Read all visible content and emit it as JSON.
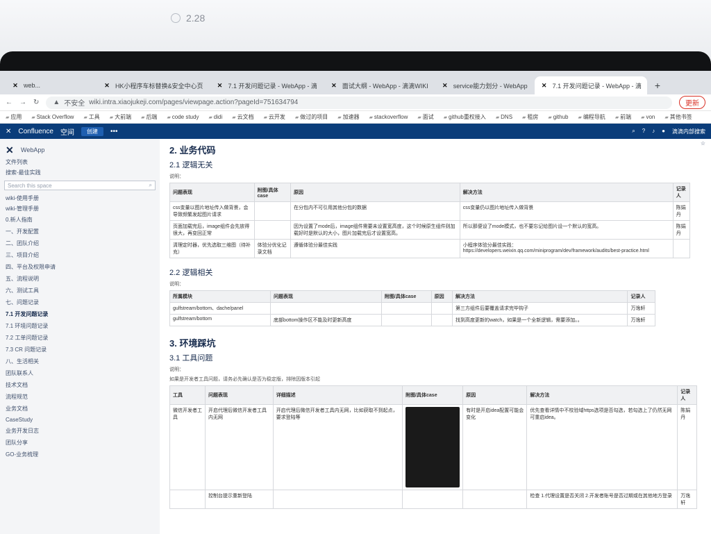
{
  "form": {
    "options": [
      "2.28"
    ]
  },
  "browser": {
    "tabs": [
      {
        "title": "web..."
      },
      {
        "title": "HK小程序车标替换&安全中心页"
      },
      {
        "title": "7.1 开发问题记录 - WebApp - 滴"
      },
      {
        "title": "面试大纲 - WebApp - 滴滴WIKI"
      },
      {
        "title": "service能力划分 - WebApp"
      },
      {
        "title": "7.1 开发问题记录 - WebApp - 滴"
      }
    ],
    "new_tab": "+",
    "insecure": "不安全",
    "url": "wiki.intra.xiaojukeji.com/pages/viewpage.action?pageId=751634794",
    "update_button": "更新",
    "bookmarks": [
      "应用",
      "Stack Overflow",
      "工具",
      "大前端",
      "后端",
      "code study",
      "didi",
      "云文档",
      "云开发",
      "做过的项目",
      "加速器",
      "stackoverflow",
      "面试",
      "github重权接入",
      "DNS",
      "租房",
      "github",
      "编程导航",
      "前端",
      "von",
      "其他书签"
    ]
  },
  "confluence": {
    "logo": "Confluence",
    "space_menu": "空间",
    "create": "创建",
    "more": "•••",
    "user": "滴滴内部搜索"
  },
  "sidebar": {
    "space_name": "WebApp",
    "links": [
      "文件列表",
      "搜索-最佳实践"
    ],
    "search_placeholder": "Search this space",
    "pages": [
      "wiki-使用手册",
      "wiki-管理手册"
    ],
    "tree": [
      {
        "label": "0.新人指南",
        "active": false
      },
      {
        "label": "一、开发配置",
        "active": false
      },
      {
        "label": "二、团队介绍",
        "active": false
      },
      {
        "label": "三、项目介绍",
        "active": false
      },
      {
        "label": "四、平台及权限申请",
        "active": false
      },
      {
        "label": "五、流程说明",
        "active": false
      },
      {
        "label": "六、测试工具",
        "active": false
      },
      {
        "label": "七、问题记录",
        "active": false
      },
      {
        "label": "7.1 开发问题记录",
        "active": true
      },
      {
        "label": "7.1 环境问题记录",
        "active": false
      },
      {
        "label": "7.2 工单问题记录",
        "active": false
      },
      {
        "label": "7.3 CR 问题记录",
        "active": false
      },
      {
        "label": "八、生活相关",
        "active": false
      },
      {
        "label": "团队联系人",
        "active": false
      },
      {
        "label": "技术文档",
        "active": false
      },
      {
        "label": "流程规范",
        "active": false
      },
      {
        "label": "业务文档",
        "active": false
      },
      {
        "label": "CaseStudy",
        "active": false
      },
      {
        "label": "业务开发日志",
        "active": false
      },
      {
        "label": "团队分享",
        "active": false
      },
      {
        "label": "GO-业务梳理",
        "active": false
      }
    ]
  },
  "content": {
    "h_business": "2. 业务代码",
    "h_logic_none": "2.1 逻辑无关",
    "desc1": "说明：",
    "table1": {
      "headers": [
        "问题表现",
        "附图/具体case",
        "原因",
        "解决方法",
        "记录人"
      ],
      "rows": [
        [
          "css变量以图片地址传入做背景，会导致频繁发起图片请求",
          "",
          "在分包内不可引用其他分包的数据",
          "css变量仍以图片地址传入做背景",
          "陈娟丹"
        ],
        [
          "页面加载完后，image组件会先放得很大，再变回正常",
          "",
          "因为设置了mode后，image组件需要未设置宽高度，这个时候原生组件则加载好时是默认的大小，图片加载完后才设置宽高。",
          "所以那便设了mode模式，也不要忘记给图片设一个默认的宽高。",
          "陈娟丹"
        ],
        [
          "清理定时器，优先选取三维图（待补充）",
          "体验分优化记录文档",
          "遵循体验分最佳实践",
          "小程序体验分最佳实践： https://developers.weixin.qq.com/miniprogram/dev/framework/audits/best-practice.html",
          ""
        ]
      ]
    },
    "h_logic_rel": "2.2 逻辑相关",
    "desc2": "说明：",
    "table2": {
      "headers": [
        "所属模块",
        "问题表现",
        "附图/具体case",
        "原因",
        "解决方法",
        "记录人"
      ],
      "rows": [
        [
          "gulfstream/bottom、dache/panel",
          "",
          "",
          "",
          "第三方组件后要覆盖请求完毕钩子",
          "万逸轩"
        ],
        [
          "gulfstream/bottom",
          "底部bottom操作区不能及时更新高度",
          "",
          "",
          "找到高度更新的watch，如果是一个全新逻辑，需要添加。。",
          "万逸轩"
        ]
      ]
    },
    "h_env": "3. 环境踩坑",
    "h_tools": "3.1 工具问题",
    "desc3": "说明：",
    "desc3b": "如果是开发者工具问题，请务必先确认是否为稳定版，排除因版本引起",
    "table3": {
      "headers": [
        "工具",
        "问题表现",
        "详细描述",
        "附图/具体case",
        "原因",
        "解决方法",
        "记录人"
      ],
      "rows": [
        [
          "微信开发者工具",
          "开启代理后微信开发者工具内无网",
          "开启代理后微信开发者工具内无网，比如获取不到起点，要求登陆等",
          "",
          "有时是开启idea配置可能会变化",
          "优先查看详情中不校验域https选项是否勾选，若勾选上了仍然无网可重启idea。",
          "陈娟丹"
        ],
        [
          "",
          "控制台提示重新登陆",
          "",
          "",
          "",
          "检查 1.代理设置是否关闭 2.开发者账号是否过期或在其他地方登录",
          "万逸轩"
        ]
      ]
    }
  }
}
